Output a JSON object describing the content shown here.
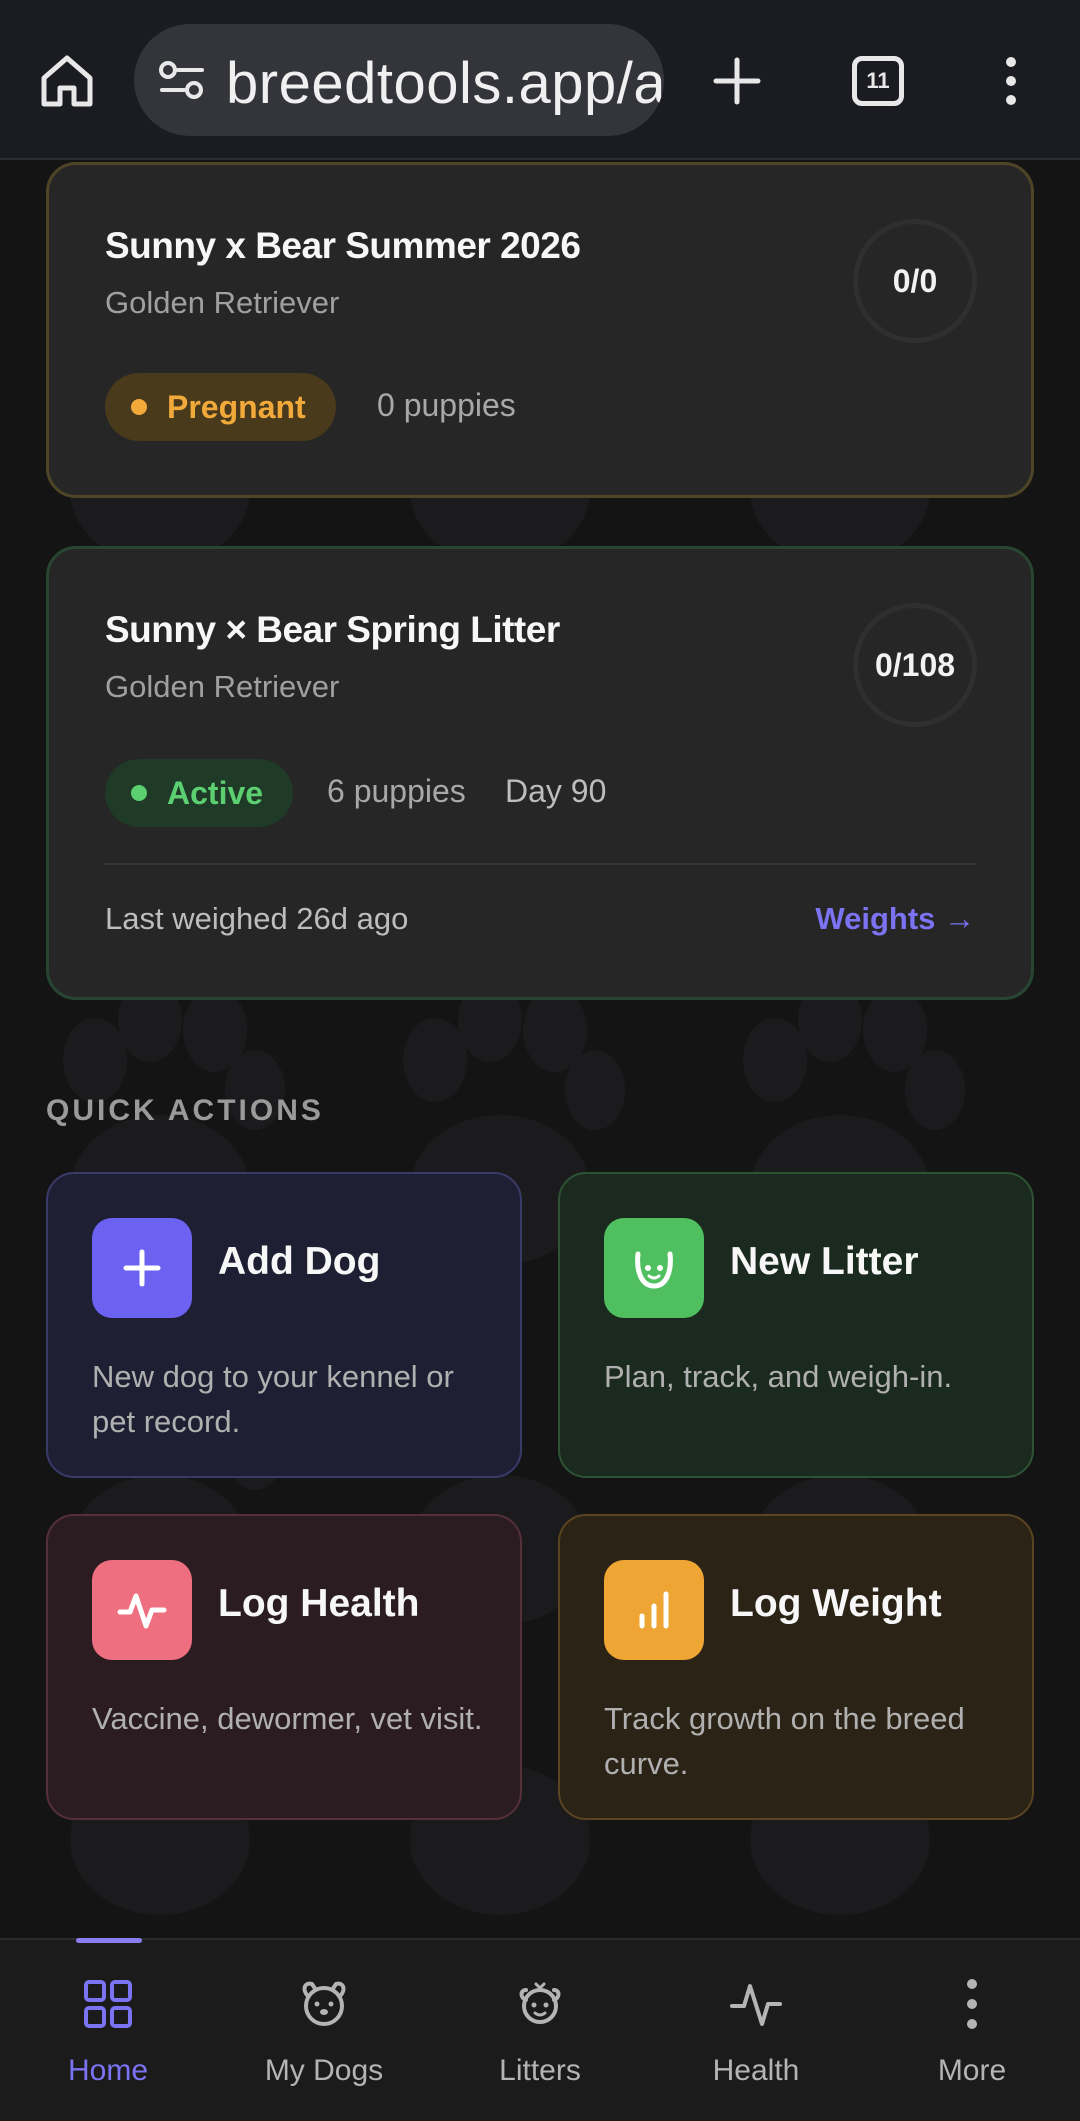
{
  "browser": {
    "url": "breedtools.app/a",
    "tab_count": "11"
  },
  "litters": [
    {
      "title": "Sunny x Bear Summer 2026",
      "breed": "Golden Retriever",
      "progress": "0/0",
      "status": "Pregnant",
      "puppies": "0 puppies"
    },
    {
      "title": "Sunny × Bear Spring Litter",
      "breed": "Golden Retriever",
      "progress": "0/108",
      "status": "Active",
      "puppies": "6 puppies",
      "day": "Day 90",
      "last_weighed": "Last weighed 26d ago",
      "weights_link": "Weights →"
    }
  ],
  "quick_actions": {
    "heading": "QUICK ACTIONS",
    "items": [
      {
        "title": "Add Dog",
        "desc": "New dog to your kennel or pet record.",
        "icon": "plus-icon",
        "color": "#6b62f2"
      },
      {
        "title": "New Litter",
        "desc": "Plan, track, and weigh-in.",
        "icon": "puppy-face-icon",
        "color": "#4fbf60"
      },
      {
        "title": "Log Health",
        "desc": "Vaccine, dewormer, vet visit.",
        "icon": "pulse-icon",
        "color": "#ee6f80"
      },
      {
        "title": "Log Weight",
        "desc": "Track growth on the breed curve.",
        "icon": "bar-chart-icon",
        "color": "#eea534"
      }
    ]
  },
  "nav": {
    "items": [
      {
        "label": "Home",
        "icon": "grid-icon",
        "active": true
      },
      {
        "label": "My Dogs",
        "icon": "dog-face-icon",
        "active": false
      },
      {
        "label": "Litters",
        "icon": "puppy-icon",
        "active": false
      },
      {
        "label": "Health",
        "icon": "pulse-icon",
        "active": false
      },
      {
        "label": "More",
        "icon": "more-vertical-icon",
        "active": false
      }
    ]
  }
}
